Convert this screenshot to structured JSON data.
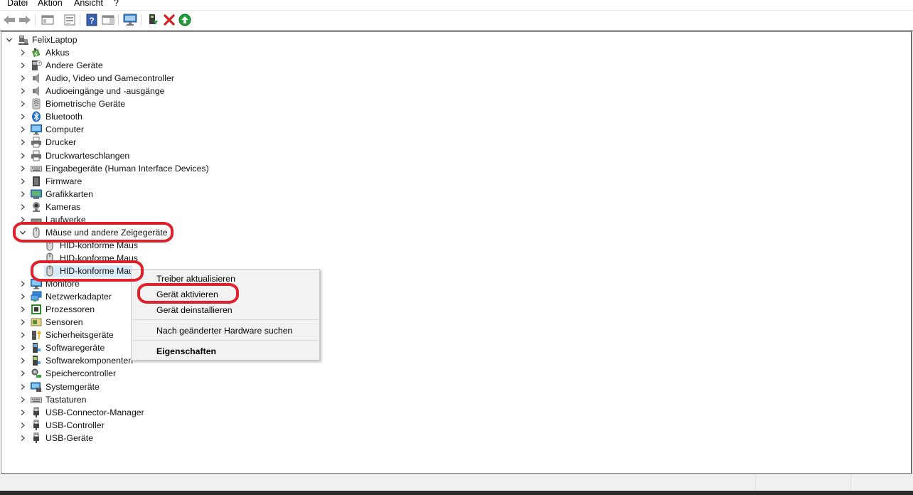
{
  "menu": [
    "Datei",
    "Aktion",
    "Ansicht",
    "?"
  ],
  "toolbar": [
    "back-icon",
    "forward-icon",
    "console-tree-icon",
    "properties-page-icon",
    "help-icon",
    "action-pane-icon",
    "scan-hardware-icon",
    "update-driver-icon",
    "uninstall-device-icon",
    "enable-device-icon"
  ],
  "tree": {
    "root": "FelixLaptop",
    "categories": [
      {
        "label": "Akkus",
        "icon": "battery-icon"
      },
      {
        "label": "Andere Geräte",
        "icon": "unknown-device-icon"
      },
      {
        "label": "Audio, Video und Gamecontroller",
        "icon": "speaker-icon"
      },
      {
        "label": "Audioeingänge und -ausgänge",
        "icon": "speaker-icon"
      },
      {
        "label": "Biometrische Geräte",
        "icon": "fingerprint-icon"
      },
      {
        "label": "Bluetooth",
        "icon": "bluetooth-icon"
      },
      {
        "label": "Computer",
        "icon": "monitor-icon"
      },
      {
        "label": "Drucker",
        "icon": "printer-icon"
      },
      {
        "label": "Druckwarteschlangen",
        "icon": "printer-icon"
      },
      {
        "label": "Eingabegeräte (Human Interface Devices)",
        "icon": "keyboard-icon"
      },
      {
        "label": "Firmware",
        "icon": "chip-icon"
      },
      {
        "label": "Grafikkarten",
        "icon": "display-adapter-icon"
      },
      {
        "label": "Kameras",
        "icon": "camera-icon"
      },
      {
        "label": "Laufwerke",
        "icon": "disk-icon"
      },
      {
        "label": "Mäuse und andere Zeigegeräte",
        "icon": "mouse-icon"
      }
    ],
    "mouse_children": [
      "HID-konforme Maus",
      "HID-konforme Maus",
      "HID-konforme Maus"
    ],
    "categories_after": [
      {
        "label": "Monitore",
        "icon": "monitor-icon"
      },
      {
        "label": "Netzwerkadapter",
        "icon": "network-icon"
      },
      {
        "label": "Prozessoren",
        "icon": "processor-icon"
      },
      {
        "label": "Sensoren",
        "icon": "sensor-icon"
      },
      {
        "label": "Sicherheitsgeräte",
        "icon": "security-key-icon"
      },
      {
        "label": "Softwaregeräte",
        "icon": "software-device-icon"
      },
      {
        "label": "Softwarekomponenten",
        "icon": "software-component-icon"
      },
      {
        "label": "Speichercontroller",
        "icon": "storage-controller-icon"
      },
      {
        "label": "Systemgeräte",
        "icon": "system-device-icon"
      },
      {
        "label": "Tastaturen",
        "icon": "keyboard-icon"
      },
      {
        "label": "USB-Connector-Manager",
        "icon": "usb-icon"
      },
      {
        "label": "USB-Controller",
        "icon": "usb-icon"
      },
      {
        "label": "USB-Geräte",
        "icon": "usb-icon"
      }
    ]
  },
  "context_menu": {
    "items": [
      "Treiber aktualisieren",
      "Gerät aktivieren",
      "Gerät deinstallieren",
      "Nach geänderter Hardware suchen",
      "Eigenschaften"
    ]
  },
  "colors": {
    "annotation": "#e0202a",
    "selection": "#d9ebf9"
  }
}
